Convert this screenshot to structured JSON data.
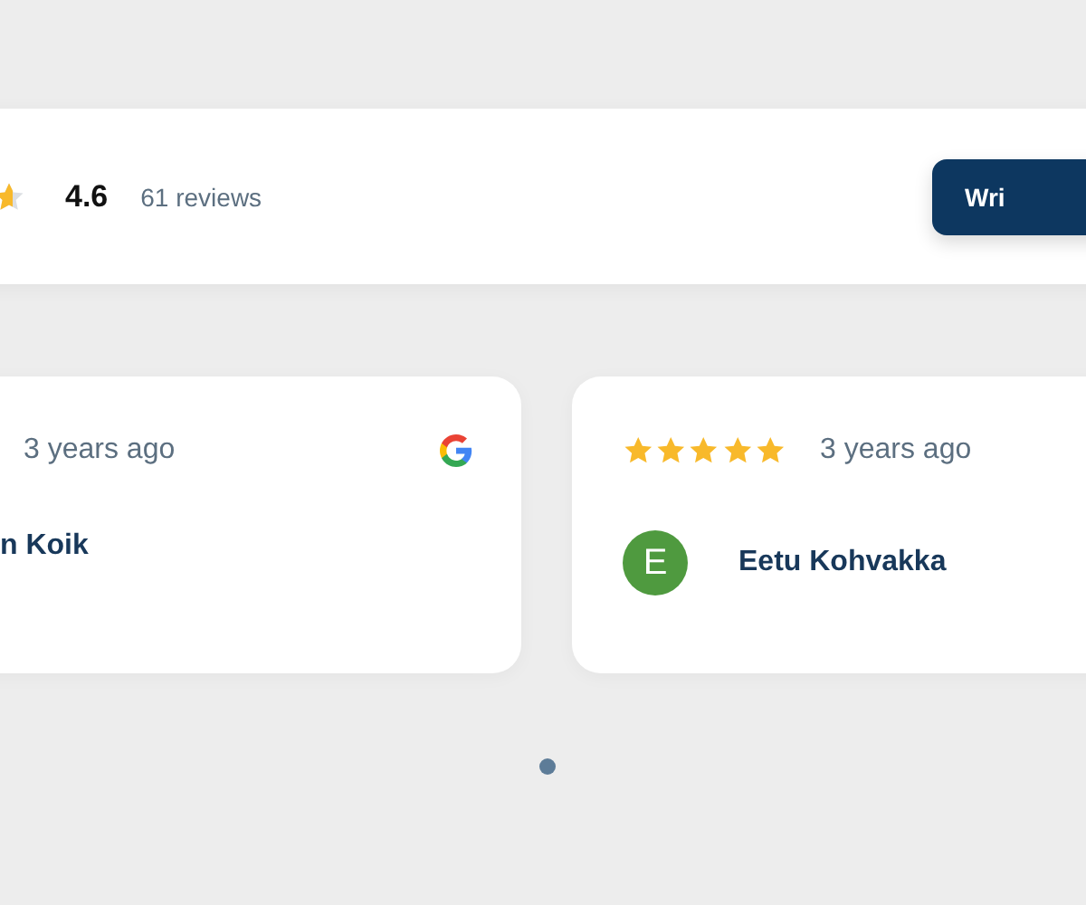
{
  "header": {
    "rating": "4.6",
    "count": "61 reviews",
    "button": "Wri"
  },
  "reviews": [
    {
      "date": "3 years ago",
      "google_badge": true,
      "name": "n Koik"
    },
    {
      "stars": 5,
      "date": "3 years ago",
      "avatar": "E",
      "color": "#4f9a3f",
      "name": "Eetu Kohvakka"
    }
  ],
  "pagination": [
    {
      "selected": true
    }
  ]
}
